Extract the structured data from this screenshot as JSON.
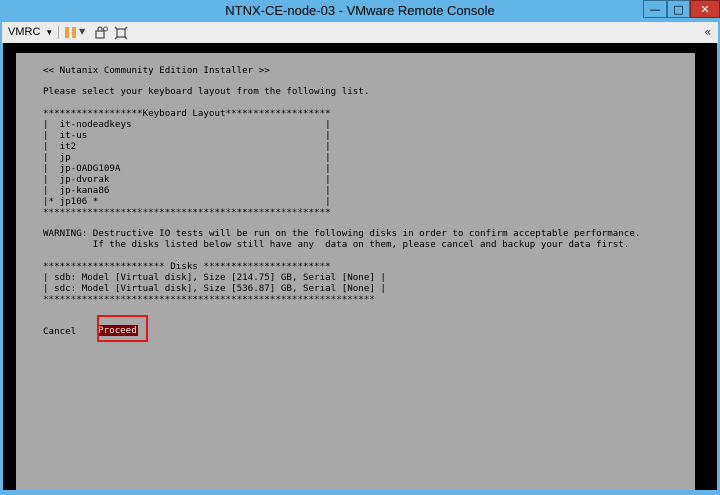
{
  "window": {
    "title": "NTNX-CE-node-03 - VMware Remote Console",
    "minimize_label": "—",
    "maximize_label": "□",
    "close_label": "✕"
  },
  "toolbar": {
    "vmrc_label": "VMRC",
    "menu_caret": "▼",
    "pause_caret": "▼",
    "collapse_label": "«",
    "icons": [
      "pause-icon",
      "send-ctrl-alt-del-icon",
      "fit-window-icon",
      "collapse-icon"
    ]
  },
  "installer": {
    "header": "<< Nutanix Community Edition Installer >>",
    "prompt": "Please select your keyboard layout from the following list.",
    "keyboard_box_top": "******************Keyboard Layout*******************",
    "keyboard_items": [
      "|  it-nodeadkeys                                   |",
      "|  it-us                                           |",
      "|  it2                                             |",
      "|  jp                                              |",
      "|  jp-OADG109A                                     |",
      "|  jp-dvorak                                       |",
      "|  jp-kana86                                       |",
      "|* jp106 *                                         |"
    ],
    "keyboard_box_bottom": "****************************************************",
    "warning_line1": "WARNING: Destructive IO tests will be run on the following disks in order to confirm acceptable performance.",
    "warning_line2": "         If the disks listed below still have any  data on them, please cancel and backup your data first.",
    "disks_top": "********************** Disks ***********************",
    "disks": [
      "| sdb: Model [Virtual disk], Size [214.75] GB, Serial [None] |",
      "| sdc: Model [Virtual disk], Size [536.87] GB, Serial [None] |"
    ],
    "disks_bottom": "************************************************************",
    "cancel_label": "Cancel",
    "proceed_label": "Proceed",
    "selected_keyboard": "jp106"
  }
}
